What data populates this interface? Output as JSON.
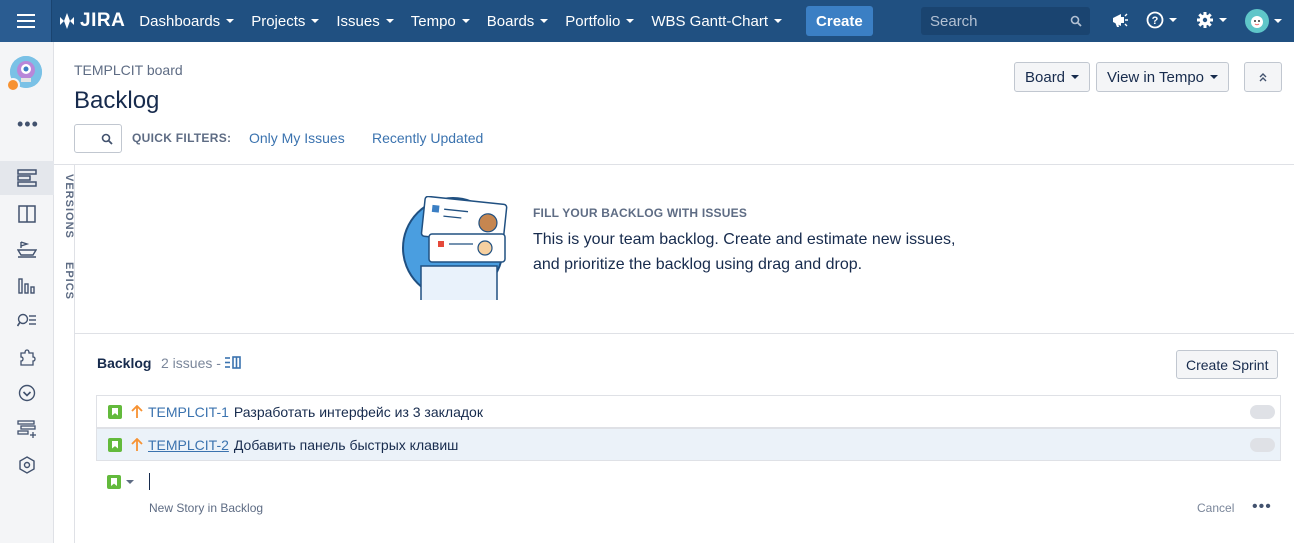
{
  "topbar": {
    "logo": "JIRA",
    "nav": [
      "Dashboards",
      "Projects",
      "Issues",
      "Tempo",
      "Boards",
      "Portfolio",
      "WBS Gantt-Chart"
    ],
    "create_label": "Create",
    "search_placeholder": "Search"
  },
  "header": {
    "breadcrumb": "TEMPLCIT board",
    "title": "Backlog",
    "board_btn": "Board",
    "tempo_btn": "View in Tempo"
  },
  "quick_filters": {
    "label": "QUICK FILTERS:",
    "filters": [
      "Only My Issues",
      "Recently Updated"
    ]
  },
  "side_tabs": {
    "versions": "VERSIONS",
    "epics": "EPICS"
  },
  "empty_state": {
    "title": "FILL YOUR BACKLOG WITH ISSUES",
    "text": "This is your team backlog. Create and estimate new issues, and prioritize the backlog using drag and drop."
  },
  "backlog": {
    "title": "Backlog",
    "count": "2 issues -",
    "create_sprint": "Create Sprint",
    "issues": [
      {
        "key": "TEMPLCIT-1",
        "summary": "Разработать интерфейс из 3 закладок"
      },
      {
        "key": "TEMPLCIT-2",
        "summary": "Добавить панель быстрых клавиш"
      }
    ],
    "new_hint": "New Story in Backlog",
    "cancel": "Cancel"
  },
  "colors": {
    "topbar": "#205081",
    "accent": "#3b7fc4",
    "story": "#63ba3c",
    "priority": "#f79232"
  }
}
